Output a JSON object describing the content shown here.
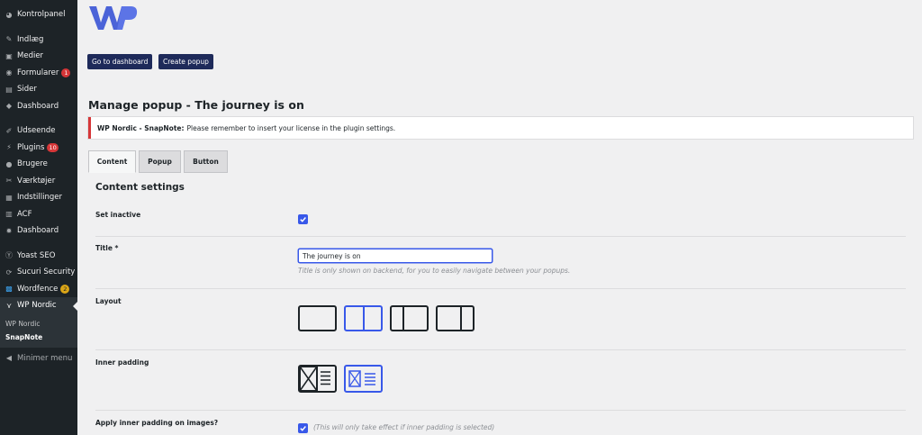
{
  "sidebar": {
    "items": [
      {
        "label": "Kontrolpanel",
        "icon": "dashboard-icon"
      },
      {
        "label": "Indlæg",
        "icon": "pin-icon"
      },
      {
        "label": "Medier",
        "icon": "media-icon"
      },
      {
        "label": "Formularer",
        "icon": "forms-icon",
        "badge": "1"
      },
      {
        "label": "Sider",
        "icon": "pages-icon"
      },
      {
        "label": "Dashboard",
        "icon": "dashboard-icon"
      },
      {
        "label": "Udseende",
        "icon": "brush-icon"
      },
      {
        "label": "Plugins",
        "icon": "plugin-icon",
        "badge": "10"
      },
      {
        "label": "Brugere",
        "icon": "user-icon"
      },
      {
        "label": "Værktøjer",
        "icon": "wrench-icon"
      },
      {
        "label": "Indstillinger",
        "icon": "settings-icon"
      },
      {
        "label": "ACF",
        "icon": "grid-icon"
      },
      {
        "label": "Dashboard",
        "icon": "gear-icon"
      },
      {
        "label": "Yoast SEO",
        "icon": "yoast-icon"
      },
      {
        "label": "Sucuri Security",
        "icon": "sucuri-icon"
      },
      {
        "label": "Wordfence",
        "icon": "wordfence-icon",
        "badge": "2"
      },
      {
        "label": "WP Nordic",
        "icon": "wp-nordic-icon"
      }
    ],
    "submenu": [
      "WP Nordic",
      "SnapNote"
    ],
    "collapse_label": "Minimer menu"
  },
  "header": {
    "go_dashboard_label": "Go to dashboard",
    "create_popup_label": "Create popup",
    "page_title": "Manage popup - The journey is on"
  },
  "notice": {
    "strong": "WP Nordic - SnapNote:",
    "text": "Please remember to insert your license in the plugin settings."
  },
  "tabs": [
    "Content",
    "Popup",
    "Button"
  ],
  "content": {
    "section_title": "Content settings",
    "set_inactive_label": "Set inactive",
    "set_inactive_checked": true,
    "title_label": "Title *",
    "title_value": "The journey is on",
    "title_help": "Title is only shown on backend, for you to easily navigate between your popups.",
    "layout_label": "Layout",
    "layout_selected_index": 1,
    "inner_padding_label": "Inner padding",
    "inner_padding_selected_index": 1,
    "apply_padding_label": "Apply inner padding on images?",
    "apply_padding_checked": true,
    "apply_padding_help": "(This will only take effect if inner padding is selected)"
  },
  "colors": {
    "accent": "#3858e9",
    "button_bg": "#1e2a5a",
    "sidebar_bg": "#1d2327",
    "badge_red": "#d63638",
    "badge_yellow": "#dba617"
  }
}
